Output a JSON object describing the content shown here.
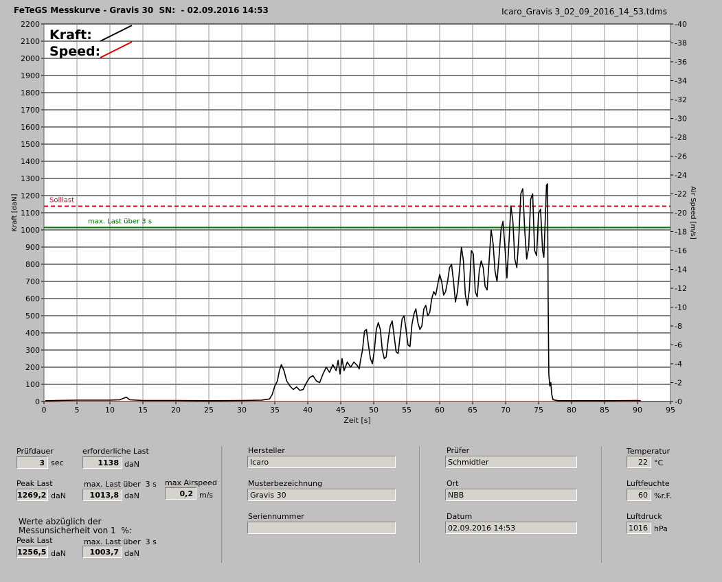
{
  "header": {
    "title": "FeTeGS Messkurve - Gravis 30  SN:  - 02.09.2016 14:53",
    "filename": "Icaro_Gravis 3_02_09_2016_14_53.tdms"
  },
  "chart_data": {
    "type": "line",
    "xlabel": "Zeit [s]",
    "ylabel": "Kraft [daN]",
    "y2label": "Air Speed [m/s]",
    "xlim": [
      0,
      95
    ],
    "ylim": [
      0,
      2200
    ],
    "y2lim": [
      0,
      40
    ],
    "x_ticks": [
      "0",
      "5",
      "10",
      "15",
      "20",
      "25",
      "30",
      "35",
      "40",
      "45",
      "50",
      "55",
      "60",
      "65",
      "70",
      "75",
      "80",
      "85",
      "90",
      "95"
    ],
    "y_ticks": [
      "0",
      "100",
      "200",
      "300",
      "400",
      "500",
      "600",
      "700",
      "800",
      "900",
      "1000",
      "1100",
      "1200",
      "1300",
      "1400",
      "1500",
      "1600",
      "1700",
      "1800",
      "1900",
      "2000",
      "2100",
      "2200"
    ],
    "y2_ticks": [
      "0",
      "2",
      "4",
      "6",
      "8",
      "10",
      "12",
      "14",
      "16",
      "18",
      "20",
      "22",
      "24",
      "26",
      "28",
      "30",
      "32",
      "34",
      "36",
      "38",
      "40"
    ],
    "grid": true,
    "legend": [
      {
        "name": "Kraft:",
        "color": "#000000"
      },
      {
        "name": "Speed:",
        "color": "#e00000"
      }
    ],
    "reference_lines": [
      {
        "label": "Solllast",
        "value": 1138,
        "color": "#e00020",
        "style": "dashed"
      },
      {
        "label": "max. Last über  3 s",
        "value": 1013.8,
        "color": "#007000",
        "style": "solid"
      }
    ],
    "series": [
      {
        "name": "Kraft",
        "color": "#000000",
        "points": [
          [
            0.2,
            5
          ],
          [
            5,
            8
          ],
          [
            10,
            8
          ],
          [
            11.5,
            10
          ],
          [
            12,
            18
          ],
          [
            12.5,
            25
          ],
          [
            13,
            10
          ],
          [
            15,
            6
          ],
          [
            20,
            6
          ],
          [
            25,
            5
          ],
          [
            30,
            6
          ],
          [
            33,
            8
          ],
          [
            34.2,
            15
          ],
          [
            34.6,
            40
          ],
          [
            35,
            90
          ],
          [
            35.4,
            120
          ],
          [
            35.7,
            180
          ],
          [
            36,
            215
          ],
          [
            36.4,
            180
          ],
          [
            36.8,
            120
          ],
          [
            37.3,
            90
          ],
          [
            37.8,
            70
          ],
          [
            38.3,
            85
          ],
          [
            38.8,
            65
          ],
          [
            39.3,
            70
          ],
          [
            39.8,
            110
          ],
          [
            40.3,
            140
          ],
          [
            40.8,
            150
          ],
          [
            41.3,
            120
          ],
          [
            41.8,
            110
          ],
          [
            42.3,
            160
          ],
          [
            42.8,
            200
          ],
          [
            43.3,
            170
          ],
          [
            43.8,
            215
          ],
          [
            44.3,
            180
          ],
          [
            44.6,
            240
          ],
          [
            44.9,
            160
          ],
          [
            45.2,
            250
          ],
          [
            45.5,
            180
          ],
          [
            46,
            230
          ],
          [
            46.5,
            200
          ],
          [
            47,
            230
          ],
          [
            47.5,
            210
          ],
          [
            47.8,
            190
          ],
          [
            48,
            240
          ],
          [
            48.3,
            300
          ],
          [
            48.6,
            410
          ],
          [
            48.9,
            420
          ],
          [
            49.2,
            330
          ],
          [
            49.5,
            250
          ],
          [
            49.8,
            220
          ],
          [
            50.1,
            300
          ],
          [
            50.4,
            420
          ],
          [
            50.7,
            460
          ],
          [
            51,
            420
          ],
          [
            51.3,
            300
          ],
          [
            51.6,
            250
          ],
          [
            51.9,
            260
          ],
          [
            52.2,
            360
          ],
          [
            52.5,
            440
          ],
          [
            52.8,
            470
          ],
          [
            53.1,
            380
          ],
          [
            53.4,
            290
          ],
          [
            53.7,
            280
          ],
          [
            54,
            380
          ],
          [
            54.3,
            480
          ],
          [
            54.6,
            500
          ],
          [
            54.9,
            420
          ],
          [
            55.2,
            330
          ],
          [
            55.5,
            320
          ],
          [
            55.8,
            450
          ],
          [
            56.1,
            510
          ],
          [
            56.4,
            540
          ],
          [
            56.7,
            460
          ],
          [
            57,
            420
          ],
          [
            57.3,
            440
          ],
          [
            57.6,
            540
          ],
          [
            57.9,
            560
          ],
          [
            58.2,
            500
          ],
          [
            58.5,
            520
          ],
          [
            58.8,
            600
          ],
          [
            59.1,
            640
          ],
          [
            59.4,
            620
          ],
          [
            59.7,
            680
          ],
          [
            60,
            740
          ],
          [
            60.3,
            700
          ],
          [
            60.6,
            620
          ],
          [
            60.9,
            640
          ],
          [
            61.2,
            700
          ],
          [
            61.5,
            780
          ],
          [
            61.8,
            800
          ],
          [
            62.1,
            700
          ],
          [
            62.4,
            580
          ],
          [
            62.7,
            640
          ],
          [
            63,
            760
          ],
          [
            63.3,
            900
          ],
          [
            63.6,
            820
          ],
          [
            63.9,
            620
          ],
          [
            64.2,
            560
          ],
          [
            64.5,
            650
          ],
          [
            64.8,
            880
          ],
          [
            65.1,
            860
          ],
          [
            65.4,
            640
          ],
          [
            65.7,
            610
          ],
          [
            66,
            760
          ],
          [
            66.3,
            820
          ],
          [
            66.6,
            780
          ],
          [
            66.9,
            670
          ],
          [
            67.2,
            650
          ],
          [
            67.5,
            820
          ],
          [
            67.8,
            1000
          ],
          [
            68.1,
            920
          ],
          [
            68.4,
            760
          ],
          [
            68.7,
            700
          ],
          [
            69,
            840
          ],
          [
            69.3,
            1000
          ],
          [
            69.6,
            1050
          ],
          [
            69.9,
            900
          ],
          [
            70.2,
            720
          ],
          [
            70.5,
            920
          ],
          [
            70.8,
            1140
          ],
          [
            71.1,
            1050
          ],
          [
            71.4,
            830
          ],
          [
            71.7,
            780
          ],
          [
            72,
            950
          ],
          [
            72.3,
            1210
          ],
          [
            72.6,
            1240
          ],
          [
            72.9,
            1000
          ],
          [
            73.2,
            830
          ],
          [
            73.5,
            900
          ],
          [
            73.8,
            1180
          ],
          [
            74.1,
            1210
          ],
          [
            74.4,
            880
          ],
          [
            74.7,
            850
          ],
          [
            75,
            1100
          ],
          [
            75.3,
            1120
          ],
          [
            75.6,
            880
          ],
          [
            75.8,
            840
          ],
          [
            76,
            1050
          ],
          [
            76.2,
            1260
          ],
          [
            76.35,
            1269
          ],
          [
            76.45,
            600
          ],
          [
            76.55,
            160
          ],
          [
            76.7,
            90
          ],
          [
            76.85,
            110
          ],
          [
            77,
            40
          ],
          [
            77.2,
            10
          ],
          [
            78,
            5
          ],
          [
            85,
            5
          ],
          [
            90,
            6
          ],
          [
            90.5,
            5
          ]
        ]
      },
      {
        "name": "Speed",
        "color": "#e00000",
        "points": [
          [
            0.2,
            0
          ],
          [
            90.5,
            0
          ]
        ]
      }
    ]
  },
  "panel": {
    "pruefdauer": {
      "label": "Prüfdauer",
      "value": "3",
      "unit": "sec"
    },
    "erf_last": {
      "label": "erforderliche Last",
      "value": "1138",
      "unit": "daN"
    },
    "peak_last": {
      "label": "Peak Last",
      "value": "1269,2",
      "unit": "daN"
    },
    "max_last": {
      "label": "max. Last über  3 s",
      "value": "1013,8",
      "unit": "daN"
    },
    "max_airspeed": {
      "label": "max Airspeed",
      "value": "0,2",
      "unit": "m/s"
    },
    "werte_note": "Werte abzüglich der\nMessunsicherheit von 1  %:",
    "peak_last2": {
      "label": "Peak Last",
      "value": "1256,5",
      "unit": "daN"
    },
    "max_last2": {
      "label": "max. Last über  3 s",
      "value": "1003,7",
      "unit": "daN"
    },
    "hersteller": {
      "label": "Hersteller",
      "value": "Icaro"
    },
    "musterbezeichnung": {
      "label": "Musterbezeichnung",
      "value": "Gravis 30"
    },
    "seriennummer": {
      "label": "Seriennummer",
      "value": ""
    },
    "pruefer": {
      "label": "Prüfer",
      "value": "Schmidtler"
    },
    "ort": {
      "label": "Ort",
      "value": "NBB"
    },
    "datum": {
      "label": "Datum",
      "value": "02.09.2016 14:53"
    },
    "temperatur": {
      "label": "Temperatur",
      "value": "22",
      "unit": "°C"
    },
    "luftfeuchte": {
      "label": "Luftfeuchte",
      "value": "60",
      "unit": "%r.F."
    },
    "luftdruck": {
      "label": "Luftdruck",
      "value": "1016",
      "unit": "hPa"
    }
  }
}
